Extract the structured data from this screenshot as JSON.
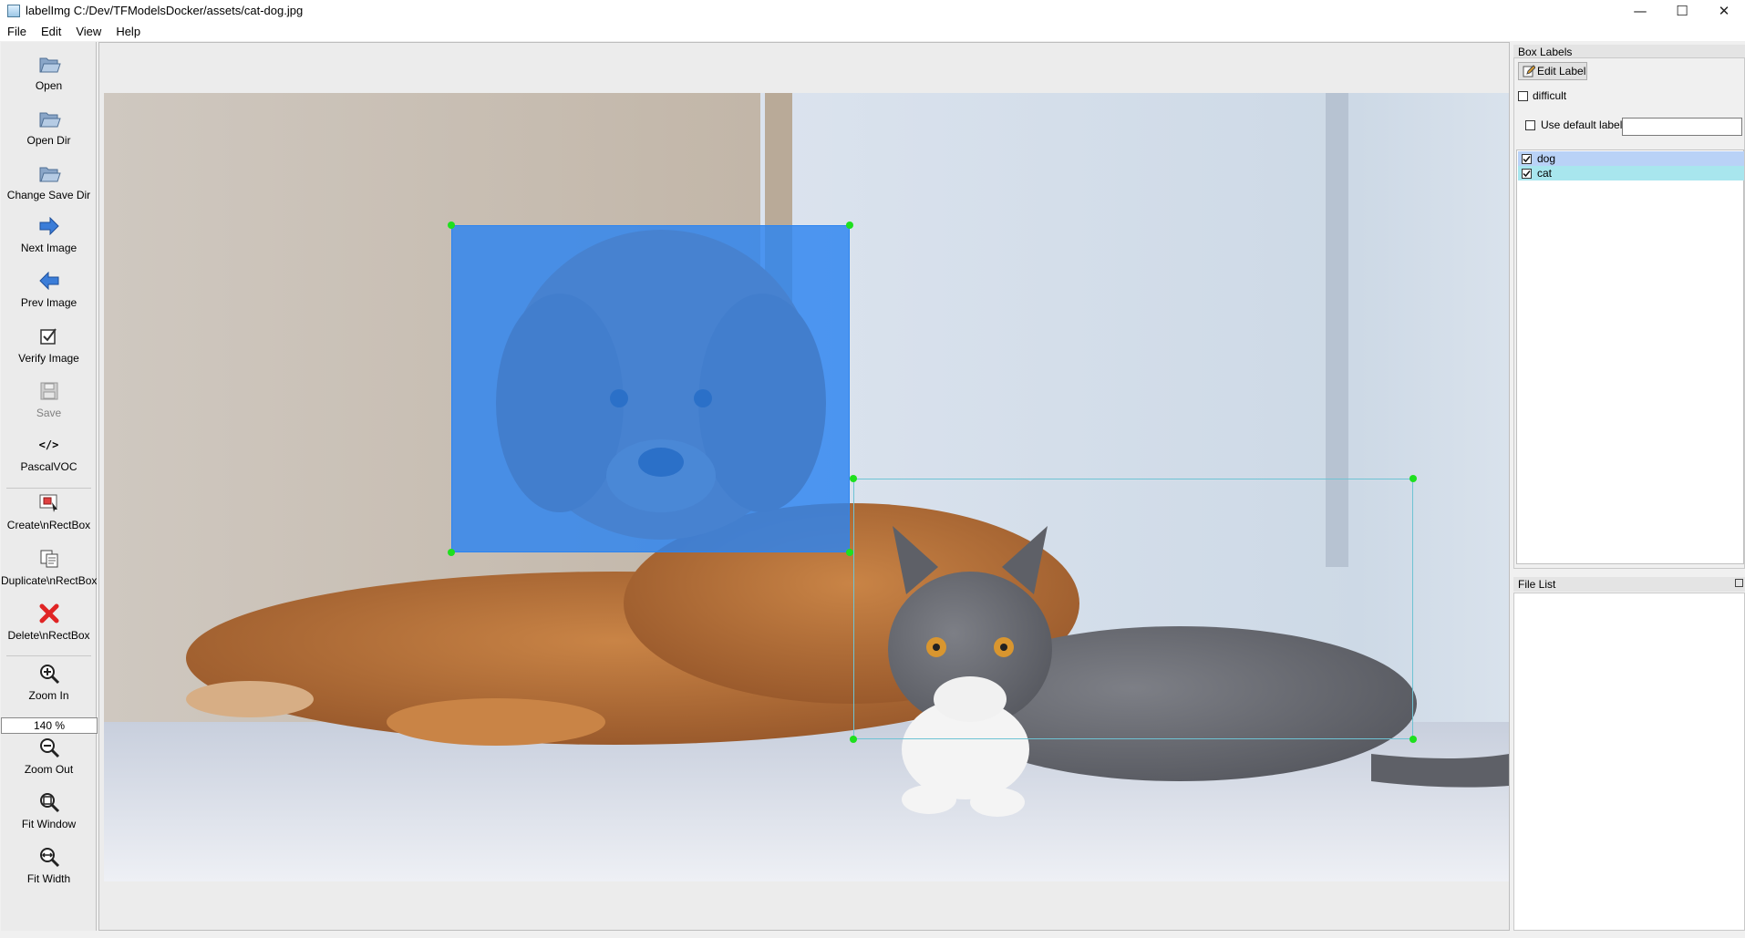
{
  "window": {
    "title": "labelImg C:/Dev/TFModelsDocker/assets/cat-dog.jpg",
    "controls": {
      "minimize": "—",
      "maximize": "☐",
      "close": "✕"
    }
  },
  "menu": [
    "File",
    "Edit",
    "View",
    "Help"
  ],
  "toolbar": {
    "open": "Open",
    "open_dir": "Open Dir",
    "change_save_dir": "Change Save Dir",
    "next_image": "Next Image",
    "prev_image": "Prev Image",
    "verify_image": "Verify Image",
    "save": "Save",
    "format_icon_text": "</>",
    "format": "PascalVOC",
    "create_rectbox": "Create\\nRectBox",
    "duplicate_rectbox": "Duplicate\\nRectBox",
    "delete_rectbox": "Delete\\nRectBox",
    "zoom_in": "Zoom In",
    "zoom_value": "140 %",
    "zoom_out": "Zoom Out",
    "fit_window": "Fit Window",
    "fit_width": "Fit Width"
  },
  "box_labels_panel": {
    "title": "Box Labels",
    "edit_label": "Edit Label",
    "difficult": "difficult",
    "use_default_label": "Use default label",
    "default_label_value": "",
    "labels": [
      {
        "text": "dog",
        "checked": true,
        "color": "#b9d2f7"
      },
      {
        "text": "cat",
        "checked": true,
        "color": "#a8e6ee"
      }
    ]
  },
  "file_list_panel": {
    "title": "File List"
  },
  "colors": {
    "dog_box_fill": "#2c84f0",
    "cat_box_line": "#6fc3d4",
    "vertex": "#1ee01e"
  }
}
